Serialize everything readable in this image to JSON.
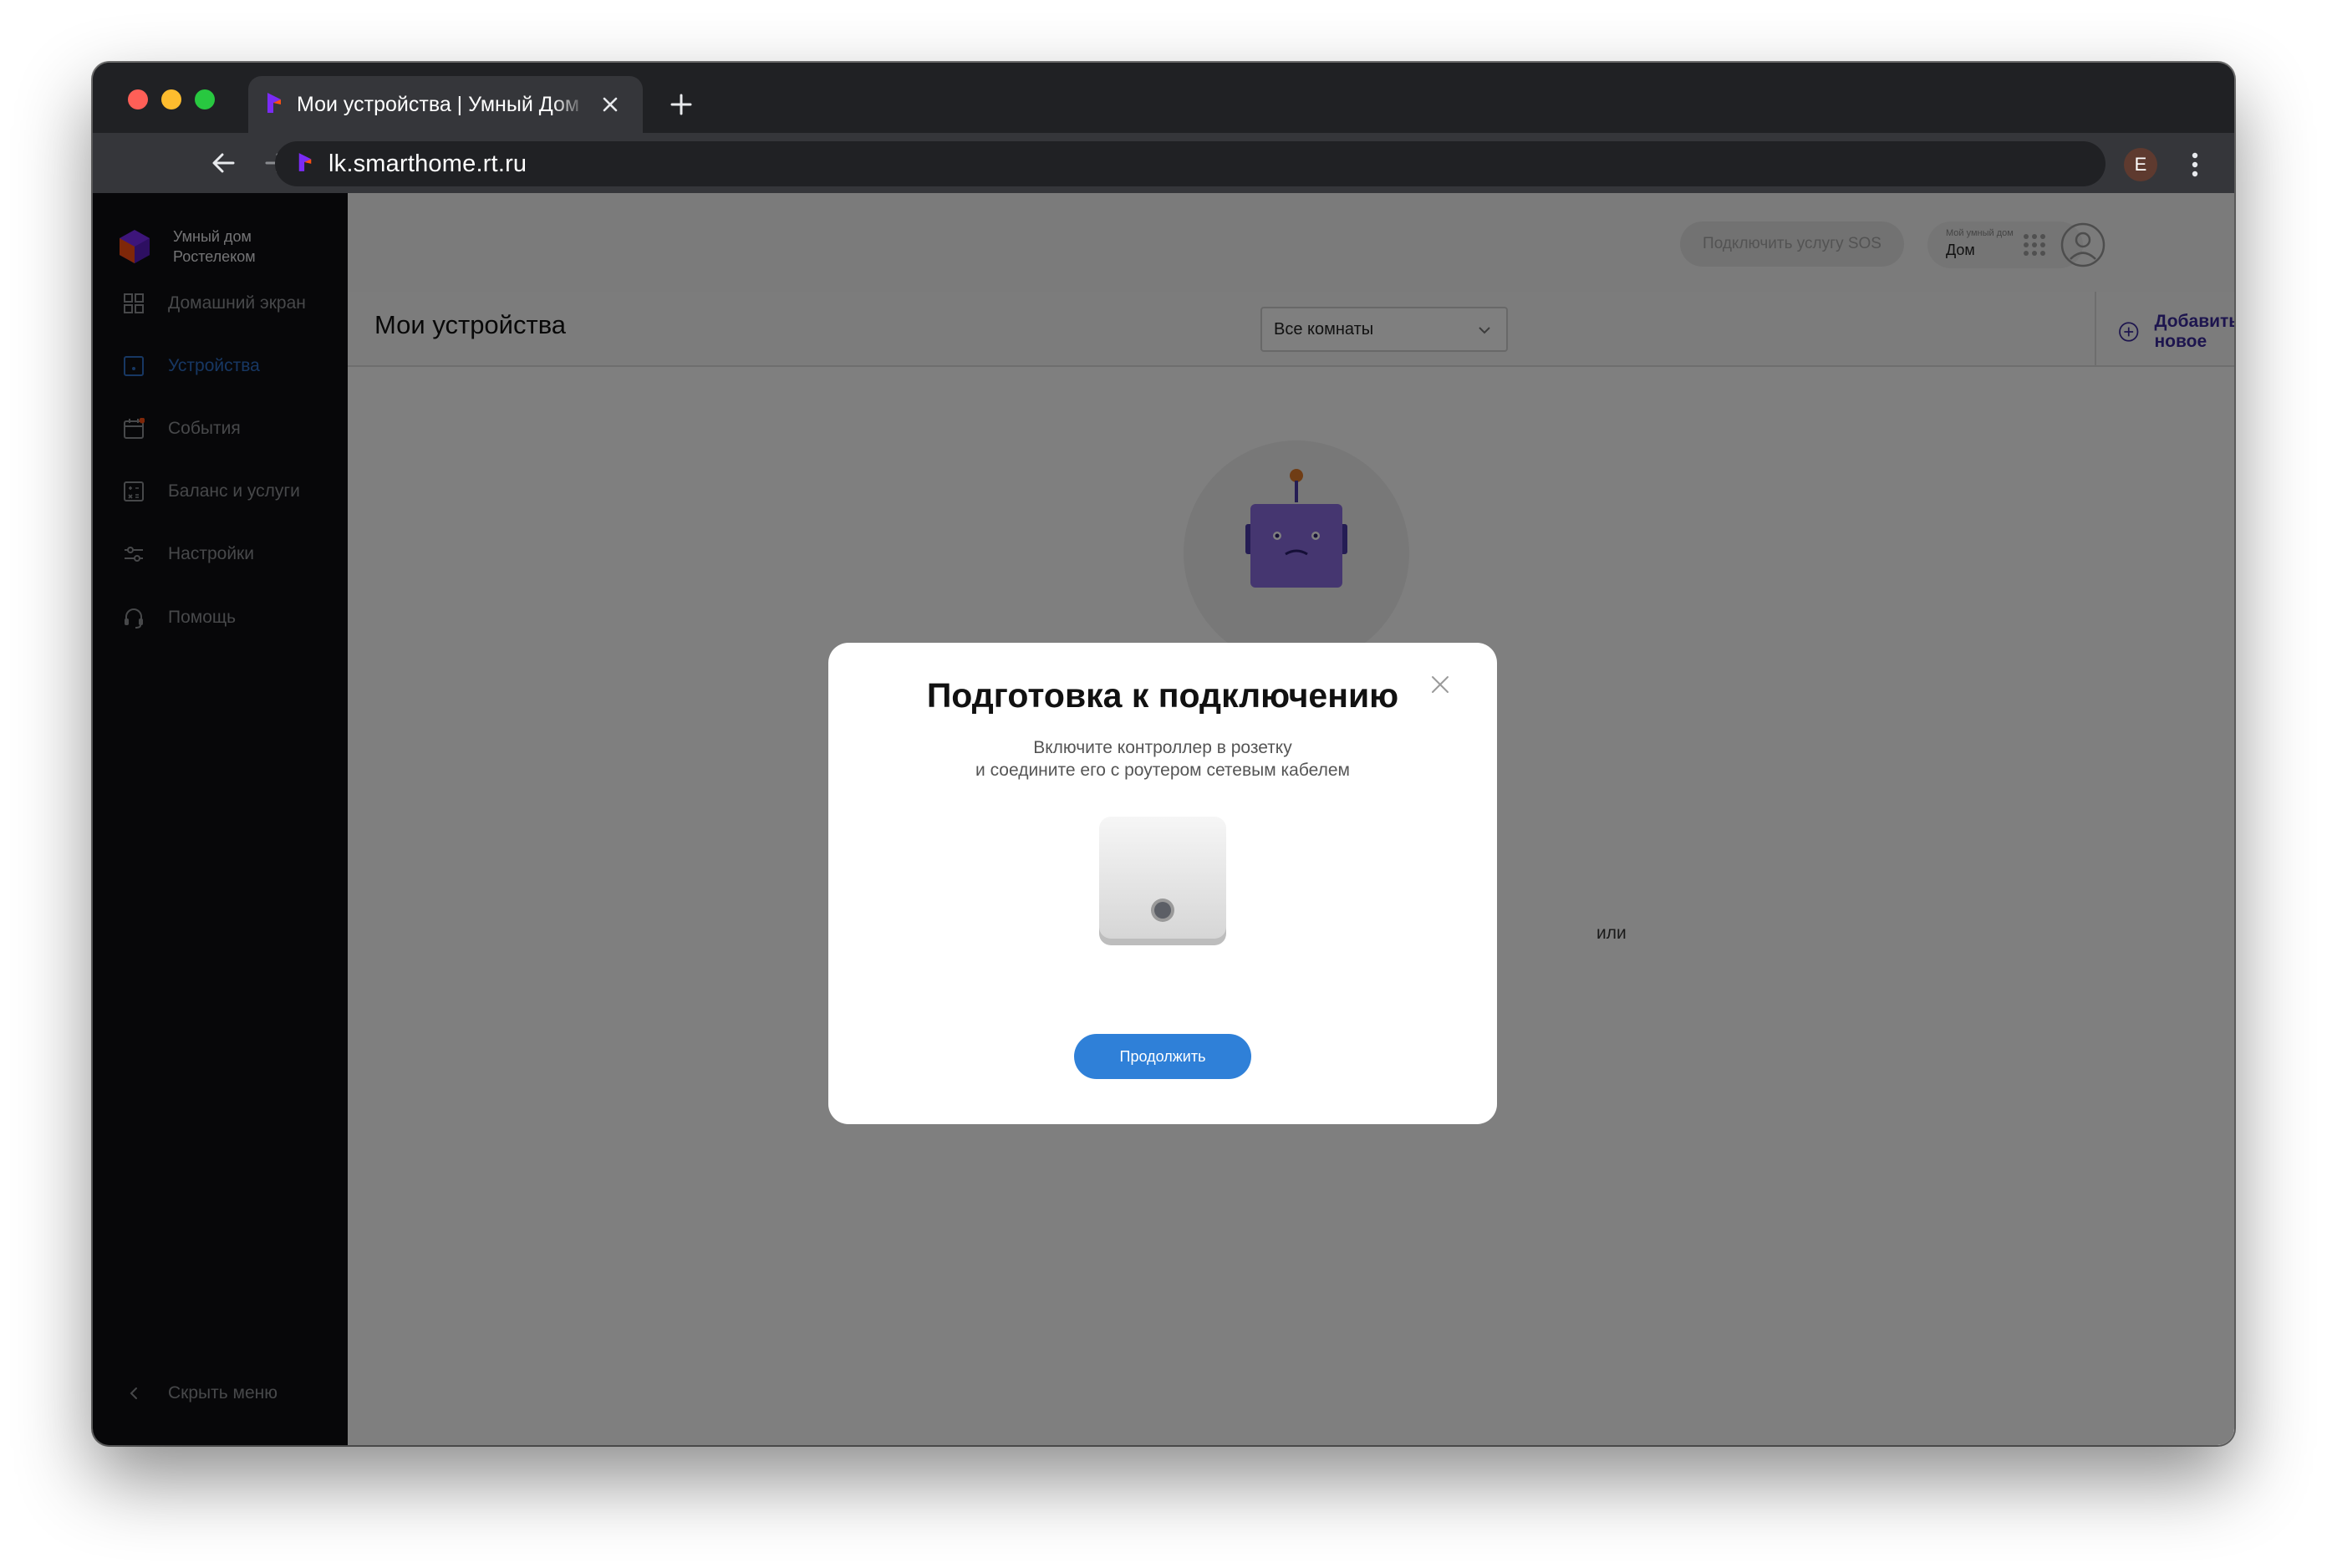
{
  "browser": {
    "tab_title": "Мои устройства | Умный Дом",
    "url": "lk.smarthome.rt.ru",
    "profile_initial": "E"
  },
  "sidebar": {
    "brand_line1": "Умный дом",
    "brand_line2": "Ростелеком",
    "items": [
      {
        "label": "Домашний экран",
        "icon": "grid-icon"
      },
      {
        "label": "Устройства",
        "icon": "device-icon",
        "active": true
      },
      {
        "label": "События",
        "icon": "calendar-icon"
      },
      {
        "label": "Баланс и услуги",
        "icon": "calculator-icon"
      },
      {
        "label": "Настройки",
        "icon": "sliders-icon"
      },
      {
        "label": "Помощь",
        "icon": "headset-icon"
      }
    ],
    "collapse_label": "Скрыть меню"
  },
  "topbar": {
    "sos_label": "Подключить услугу SOS",
    "home_label": "Мой умный дом",
    "home_value": "Дом"
  },
  "page": {
    "title": "Мои устройства",
    "room_filter": "Все комнаты",
    "add_new": "Добавить новое",
    "behind_text": "или"
  },
  "modal": {
    "title": "Подготовка к подключению",
    "text_line1": "Включите контроллер в розетку",
    "text_line2": "и соедините его с роутером сетевым кабелем",
    "continue_label": "Продолжить"
  },
  "colors": {
    "accent": "#2f80d8",
    "brand_purple": "#7b2bf5",
    "sidebar_bg": "#0e0f12",
    "active_nav": "#2f6fc7"
  }
}
